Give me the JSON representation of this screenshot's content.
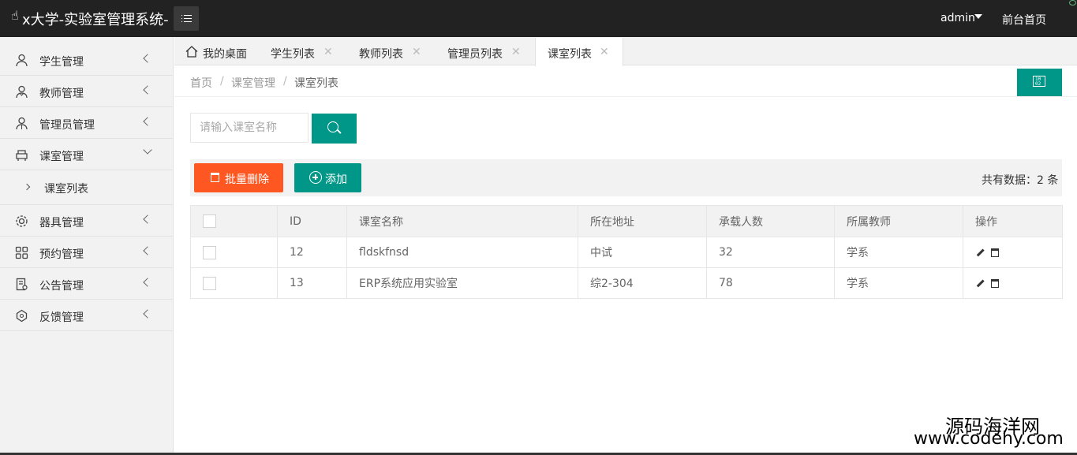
{
  "header": {
    "title": "x大学-实验室管理系统-",
    "user": "admin",
    "front_link": "前台首页"
  },
  "sidebar": {
    "items": [
      {
        "label": "学生管理",
        "icon": "user-icon"
      },
      {
        "label": "教师管理",
        "icon": "teacher-icon"
      },
      {
        "label": "管理员管理",
        "icon": "admin-icon"
      },
      {
        "label": "课室管理",
        "icon": "classroom-icon",
        "expanded": true
      },
      {
        "label": "器具管理",
        "icon": "gear-icon"
      },
      {
        "label": "预约管理",
        "icon": "grid-icon"
      },
      {
        "label": "公告管理",
        "icon": "notice-icon"
      },
      {
        "label": "反馈管理",
        "icon": "feedback-icon"
      }
    ],
    "sub_items": [
      {
        "label": "课室列表"
      }
    ]
  },
  "tabs": [
    {
      "label": "我的桌面",
      "icon": "home-icon"
    },
    {
      "label": "学生列表"
    },
    {
      "label": "教师列表"
    },
    {
      "label": "管理员列表"
    },
    {
      "label": "课室列表",
      "active": true
    }
  ],
  "breadcrumb": [
    "首页",
    "课室管理",
    "课室列表"
  ],
  "search": {
    "placeholder": "请输入课室名称"
  },
  "toolbar": {
    "batch_delete": "批量删除",
    "add": "添加",
    "total_text": "共有数据：2 条"
  },
  "table": {
    "columns": [
      "ID",
      "课室名称",
      "所在地址",
      "承载人数",
      "所属教师",
      "操作"
    ],
    "rows": [
      {
        "id": "12",
        "name": "fldskfnsd",
        "address": "中试",
        "capacity": "32",
        "teacher": "学系"
      },
      {
        "id": "13",
        "name": "ERP系统应用实验室",
        "address": "综2-304",
        "capacity": "78",
        "teacher": "学系"
      }
    ]
  },
  "watermark": {
    "line1": "源码海洋网",
    "line2": "www.codehy.com"
  },
  "colors": {
    "header_bg": "#222222",
    "accent": "#009688",
    "danger": "#FF5722",
    "sidebar_bg": "#f2f2f2"
  }
}
